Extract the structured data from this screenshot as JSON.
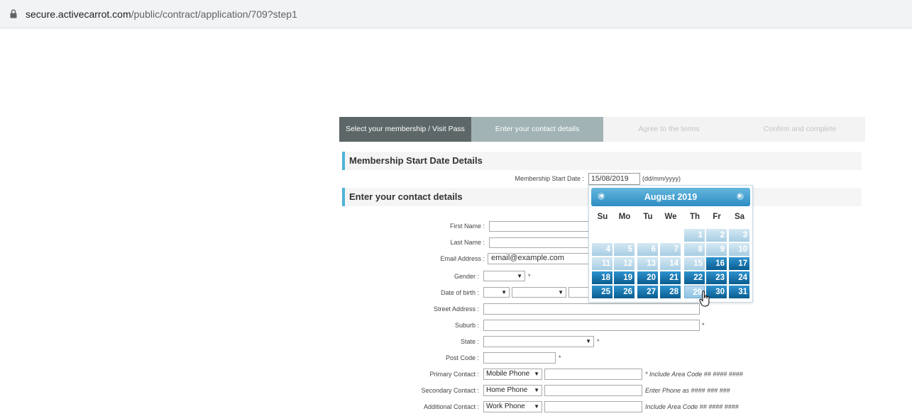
{
  "browser": {
    "url_host": "secure.activecarrot.com",
    "url_path": "/public/contract/application/709?step1"
  },
  "steps": [
    "Select your membership / Visit Pass",
    "Enter your contact details",
    "Agree to the terms",
    "Confirm and complete"
  ],
  "sections": {
    "start_date": "Membership Start Date Details",
    "contact": "Enter your contact details"
  },
  "start_date": {
    "label": "Membership Start Date :",
    "value": "15/08/2019",
    "format_hint": "(dd/mm/yyyy)"
  },
  "calendar": {
    "month_title": "August 2019",
    "prev_icon": "prev-arrow-icon",
    "next_icon": "next-arrow-icon",
    "weekdays": [
      "Su",
      "Mo",
      "Tu",
      "We",
      "Th",
      "Fr",
      "Sa"
    ],
    "rows": [
      [
        "",
        "",
        "",
        "",
        "1",
        "2",
        "3"
      ],
      [
        "4",
        "5",
        "6",
        "7",
        "8",
        "9",
        "10"
      ],
      [
        "11",
        "12",
        "13",
        "14",
        "15",
        "16",
        "17"
      ],
      [
        "18",
        "19",
        "20",
        "21",
        "22",
        "23",
        "24"
      ],
      [
        "25",
        "26",
        "27",
        "28",
        "29",
        "30",
        "31"
      ]
    ],
    "hovered_day": "29",
    "colors": {
      "header": "#3a9ad0",
      "active_day": "#0f6aa0",
      "disabled_day": "#b9dbec"
    }
  },
  "form": {
    "first_name": {
      "label": "First Name :",
      "value": ""
    },
    "last_name": {
      "label": "Last Name :",
      "value": ""
    },
    "email": {
      "label": "Email Address :",
      "value": "email@example.com"
    },
    "gender": {
      "label": "Gender :",
      "value": "",
      "required": "*"
    },
    "dob": {
      "label": "Date of birth :"
    },
    "street": {
      "label": "Street Address :",
      "value": ""
    },
    "suburb": {
      "label": "Suburb :",
      "value": "",
      "required": "*"
    },
    "state": {
      "label": "State :",
      "value": "",
      "required": "*"
    },
    "postcode": {
      "label": "Post Code :",
      "value": "",
      "required": "*"
    },
    "primary_contact": {
      "label": "Primary Contact :",
      "type": "Mobile Phone",
      "hint": "* Include Area Code ## #### ####"
    },
    "secondary_contact": {
      "label": "Secondary Contact :",
      "type": "Home Phone",
      "hint": "Enter Phone as #### ### ###"
    },
    "additional_contact": {
      "label": "Additional Contact :",
      "type": "Work Phone",
      "hint": "Include Area Code ## #### ####"
    }
  }
}
